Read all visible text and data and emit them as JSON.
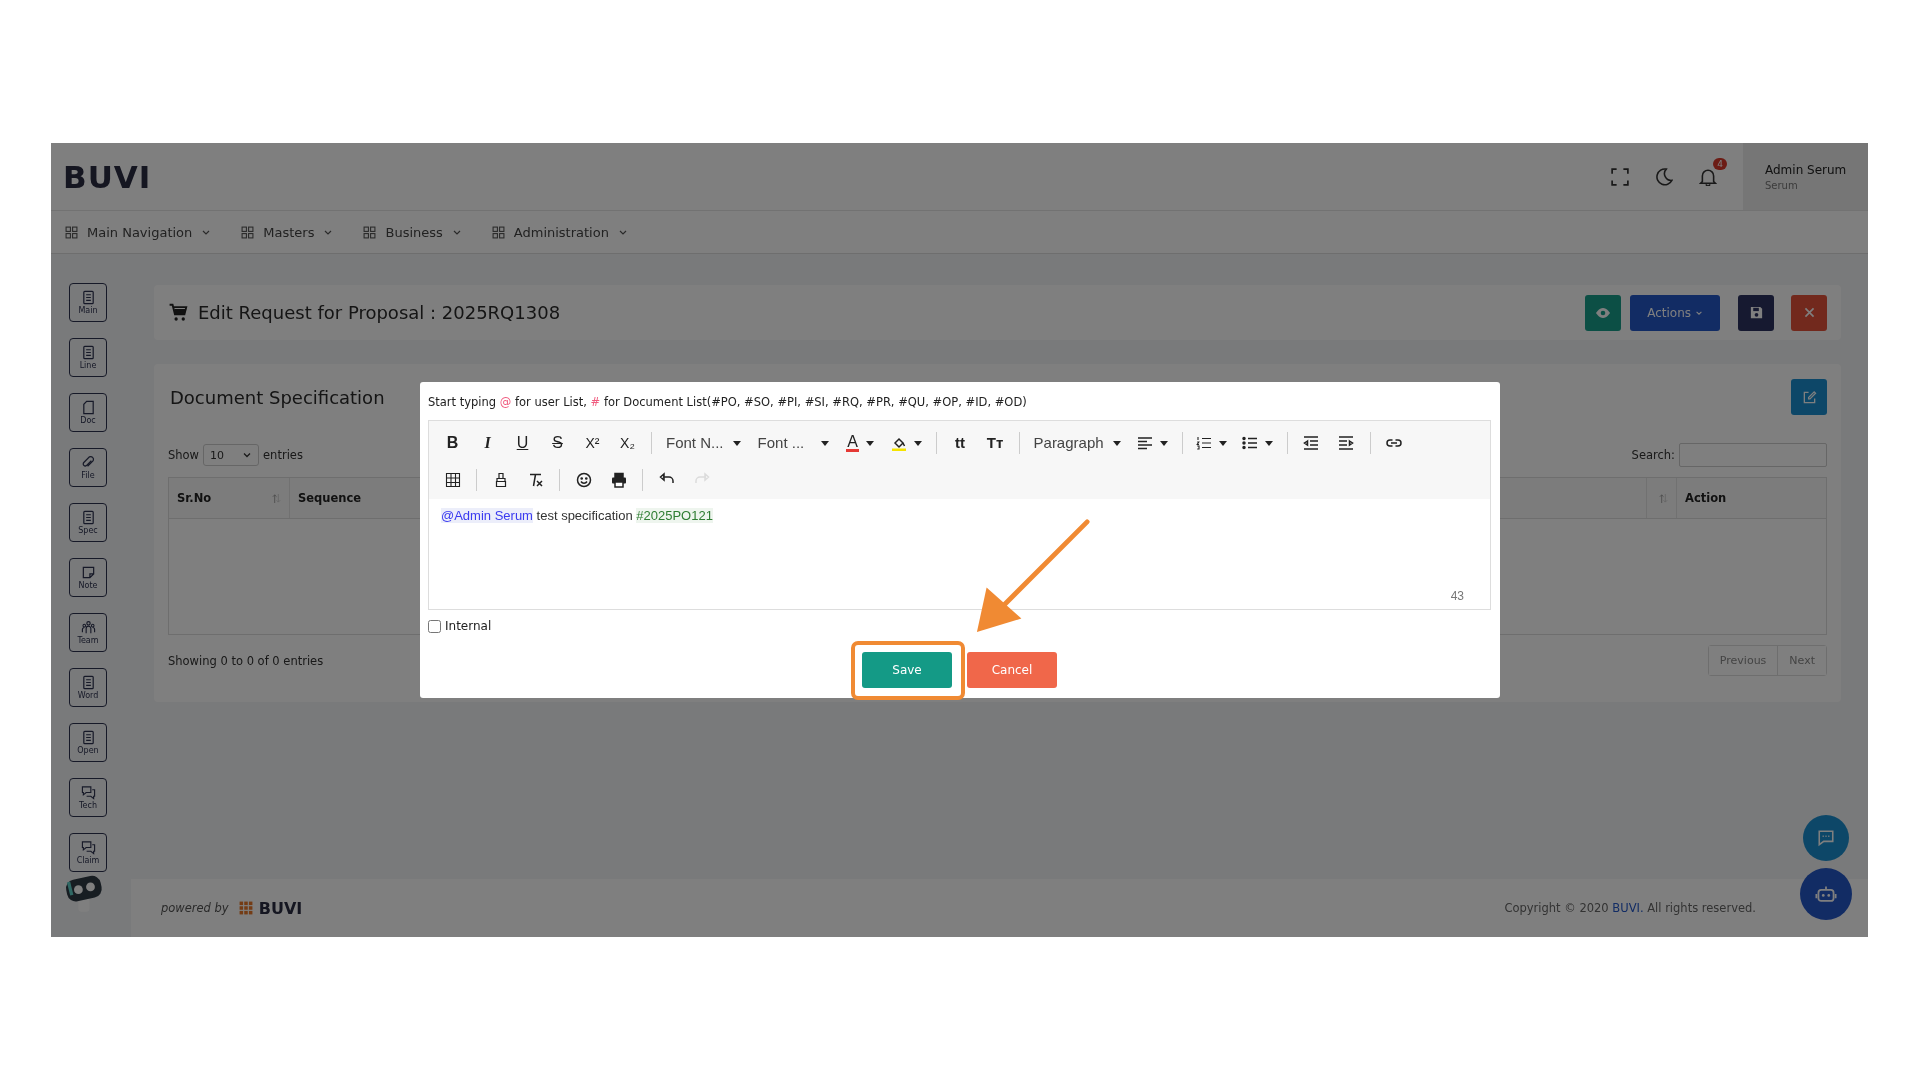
{
  "header": {
    "logo": "BUVI",
    "notification_count": "4",
    "user_name": "Admin Serum",
    "user_role": "Serum"
  },
  "nav": [
    {
      "label": "Main Navigation"
    },
    {
      "label": "Masters"
    },
    {
      "label": "Business"
    },
    {
      "label": "Administration"
    }
  ],
  "sidebar": [
    {
      "label": "Main",
      "kind": "list"
    },
    {
      "label": "Line",
      "kind": "list"
    },
    {
      "label": "Doc",
      "kind": "page"
    },
    {
      "label": "File",
      "kind": "clip"
    },
    {
      "label": "Spec",
      "kind": "list"
    },
    {
      "label": "Note",
      "kind": "note"
    },
    {
      "label": "Team",
      "kind": "team"
    },
    {
      "label": "Word",
      "kind": "list"
    },
    {
      "label": "Open",
      "kind": "list"
    },
    {
      "label": "Tech",
      "kind": "chat"
    },
    {
      "label": "Claim",
      "kind": "chat"
    }
  ],
  "page": {
    "title": "Edit Request for Proposal : 2025RQ1308",
    "actions_label": "Actions"
  },
  "section": {
    "title": "Document Specification",
    "show_label": "Show",
    "page_size": "10",
    "entries_label": "entries",
    "search_label": "Search:",
    "columns": [
      {
        "label": "Sr.No",
        "sortable": true
      },
      {
        "label": "Sequence",
        "sortable": false
      },
      {
        "sortable": true
      },
      {
        "label": "Action",
        "sortable": false
      }
    ],
    "info": "Showing 0 to 0 of 0 entries",
    "pagination": [
      "Previous",
      "Next"
    ]
  },
  "modal": {
    "hint": [
      {
        "text": "Start typing ",
        "kind": "plain"
      },
      {
        "text": "@",
        "kind": "mark"
      },
      {
        "text": " for user List, ",
        "kind": "plain"
      },
      {
        "text": "#",
        "kind": "mark"
      },
      {
        "text": " for Document List(#PO, #SO, #PI, #SI, #RQ, #PR, #QU, #OP, #ID, #OD)",
        "kind": "plain"
      }
    ],
    "toolbar_rows": [
      [
        [
          {
            "kind": "bold",
            "text": "B",
            "disabled": false
          },
          {
            "kind": "italic",
            "text": "I",
            "disabled": false
          },
          {
            "kind": "underline",
            "text": "U",
            "disabled": false
          },
          {
            "kind": "strike",
            "text": "S",
            "disabled": false
          },
          {
            "kind": "script",
            "text": "X²",
            "disabled": false
          },
          {
            "kind": "script",
            "text": "X₂",
            "disabled": false
          }
        ],
        [
          {
            "kind": "select",
            "text": "Font N...",
            "disabled": false
          },
          {
            "kind": "select",
            "text": "Font ...",
            "disabled": false
          },
          {
            "kind": "color",
            "text": "A",
            "color": "#e53935",
            "disabled": false
          },
          {
            "kind": "highlight",
            "color": "#f5e400",
            "disabled": false
          }
        ],
        [
          {
            "kind": "glyph",
            "text": "tt",
            "disabled": false
          },
          {
            "kind": "glyph",
            "text": "Tт",
            "disabled": false
          }
        ],
        [
          {
            "kind": "select",
            "text": "Paragraph",
            "disabled": false
          },
          {
            "kind": "align",
            "disabled": false
          }
        ],
        [
          {
            "kind": "numlist",
            "disabled": false
          },
          {
            "kind": "bullist",
            "disabled": false
          }
        ],
        [
          {
            "kind": "outdent",
            "disabled": false
          },
          {
            "kind": "indent",
            "disabled": false
          }
        ],
        [
          {
            "kind": "link",
            "disabled": false
          }
        ]
      ],
      [
        [
          {
            "kind": "table",
            "disabled": false
          }
        ],
        [
          {
            "kind": "brush",
            "disabled": false
          },
          {
            "kind": "clear",
            "disabled": false
          }
        ],
        [
          {
            "kind": "emoji",
            "disabled": false
          },
          {
            "kind": "print",
            "disabled": false
          }
        ],
        [
          {
            "kind": "undo",
            "disabled": false
          },
          {
            "kind": "redo",
            "disabled": true
          }
        ]
      ]
    ],
    "content": [
      {
        "text": "@Admin Serum",
        "kind": "mention"
      },
      {
        "text": " test specification ",
        "kind": "plain"
      },
      {
        "text": "#2025PO121",
        "kind": "tag"
      }
    ],
    "count": "43",
    "internal": {
      "label": "Internal",
      "checked": false
    },
    "save_label": "Save",
    "cancel_label": "Cancel"
  },
  "footer": {
    "powered_by": "powered by",
    "brand": "BUVI",
    "copyright": [
      {
        "text": "Copyright © 2020 ",
        "kind": "plain"
      },
      {
        "text": "BUVI.",
        "kind": "brand"
      },
      {
        "text": " All rights reserved.",
        "kind": "plain"
      }
    ]
  }
}
